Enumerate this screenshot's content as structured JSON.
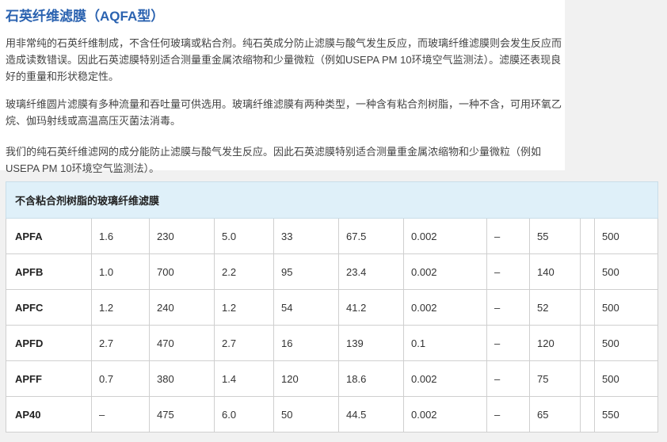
{
  "article": {
    "title": "石英纤维滤膜（AQFA型）",
    "paragraphs": [
      "用非常纯的石英纤维制成，不含任何玻璃或粘合剂。纯石英成分防止滤膜与酸气发生反应，而玻璃纤维滤膜则会发生反应而造成读数错误。因此石英滤膜特别适合测量重金属浓缩物和少量微粒（例如USEPA PM 10环境空气监测法）。滤膜还表现良好的重量和形状稳定性。",
      "玻璃纤维圆片滤膜有多种流量和吞吐量可供选用。玻璃纤维滤膜有两种类型，一种含有粘合剂树脂，一种不含，可用环氧乙烷、伽玛射线或高温高压灭菌法消毒。",
      "我们的纯石英纤维滤网的成分能防止滤膜与酸气发生反应。因此石英滤膜特别适合测量重金属浓缩物和少量微粒（例如USEPA PM 10环境空气监测法）。"
    ]
  },
  "table": {
    "header": "不含粘合剂树脂的玻璃纤维滤膜",
    "rows": [
      {
        "model": "APFA",
        "c1": "1.6",
        "c2": "230",
        "c3": "5.0",
        "c4": "33",
        "c5": "67.5",
        "c6": "0.002",
        "c7": "–",
        "c8": "55",
        "c9": "",
        "c10": "500"
      },
      {
        "model": "APFB",
        "c1": "1.0",
        "c2": "700",
        "c3": "2.2",
        "c4": "95",
        "c5": "23.4",
        "c6": "0.002",
        "c7": "–",
        "c8": "140",
        "c9": "",
        "c10": "500"
      },
      {
        "model": "APFC",
        "c1": "1.2",
        "c2": "240",
        "c3": "1.2",
        "c4": "54",
        "c5": "41.2",
        "c6": "0.002",
        "c7": "–",
        "c8": "52",
        "c9": "",
        "c10": "500"
      },
      {
        "model": "APFD",
        "c1": "2.7",
        "c2": "470",
        "c3": "2.7",
        "c4": "16",
        "c5": "139",
        "c6": "0.1",
        "c7": "–",
        "c8": "120",
        "c9": "",
        "c10": "500"
      },
      {
        "model": "APFF",
        "c1": "0.7",
        "c2": "380",
        "c3": "1.4",
        "c4": "120",
        "c5": "18.6",
        "c6": "0.002",
        "c7": "–",
        "c8": "75",
        "c9": "",
        "c10": "500"
      },
      {
        "model": "AP40",
        "c1": "–",
        "c2": "475",
        "c3": "6.0",
        "c4": "50",
        "c5": "44.5",
        "c6": "0.002",
        "c7": "–",
        "c8": "65",
        "c9": "",
        "c10": "550"
      }
    ]
  }
}
